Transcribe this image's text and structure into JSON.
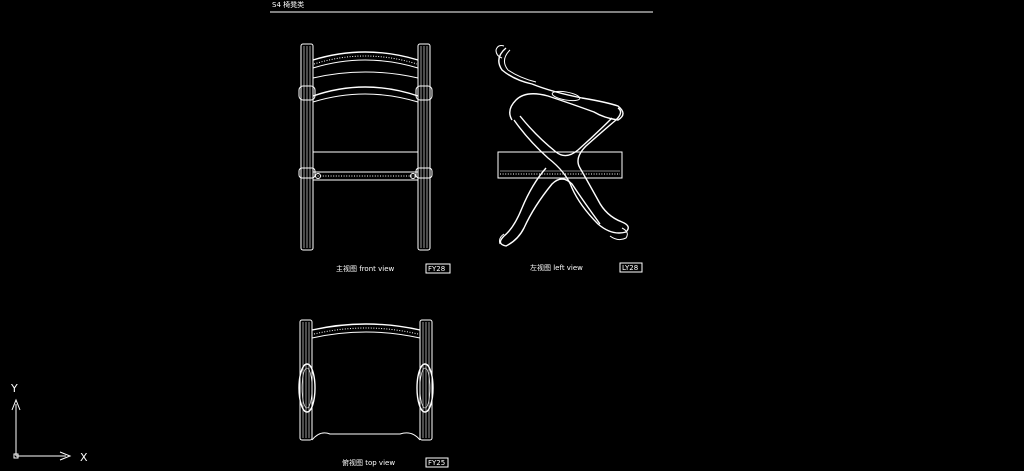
{
  "sheet": {
    "title": "S4  椅凳类"
  },
  "views": {
    "front": {
      "caption": "主视图   front view",
      "tag": "FY28"
    },
    "left": {
      "caption": "左视图   left view",
      "tag": "LY28"
    },
    "top": {
      "caption": "俯视图   top view",
      "tag": "FY25"
    }
  },
  "ucs": {
    "x_label": "X",
    "y_label": "Y"
  },
  "colors": {
    "background": "#000000",
    "linework": "#ffffff"
  }
}
